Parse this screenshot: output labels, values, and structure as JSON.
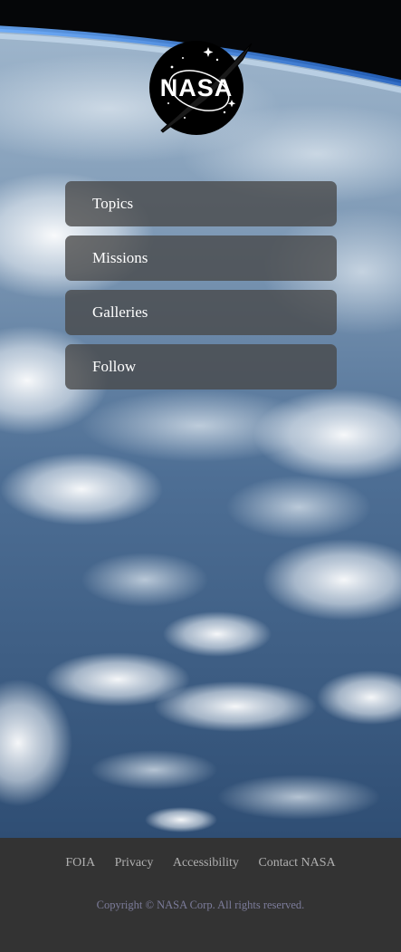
{
  "brand": {
    "logo_text": "NASA"
  },
  "nav": {
    "items": [
      {
        "label": "Topics"
      },
      {
        "label": "Missions"
      },
      {
        "label": "Galleries"
      },
      {
        "label": "Follow"
      }
    ]
  },
  "footer": {
    "links": [
      {
        "label": "FOIA"
      },
      {
        "label": "Privacy"
      },
      {
        "label": "Accessibility"
      },
      {
        "label": "Contact NASA"
      }
    ],
    "copyright": "Copyright © NASA Corp. All rights reserved."
  },
  "colors": {
    "space": "#050608",
    "atmosphere": "#4a8ee0",
    "ocean": "#3d5f86",
    "cloud": "#e8eef3",
    "nav_bg": "#484848",
    "footer_bg": "#333333",
    "footer_link": "#b0b0b0",
    "copyright": "#7c7c9a"
  },
  "icons": {
    "logo": "nasa-meatball-logo"
  }
}
